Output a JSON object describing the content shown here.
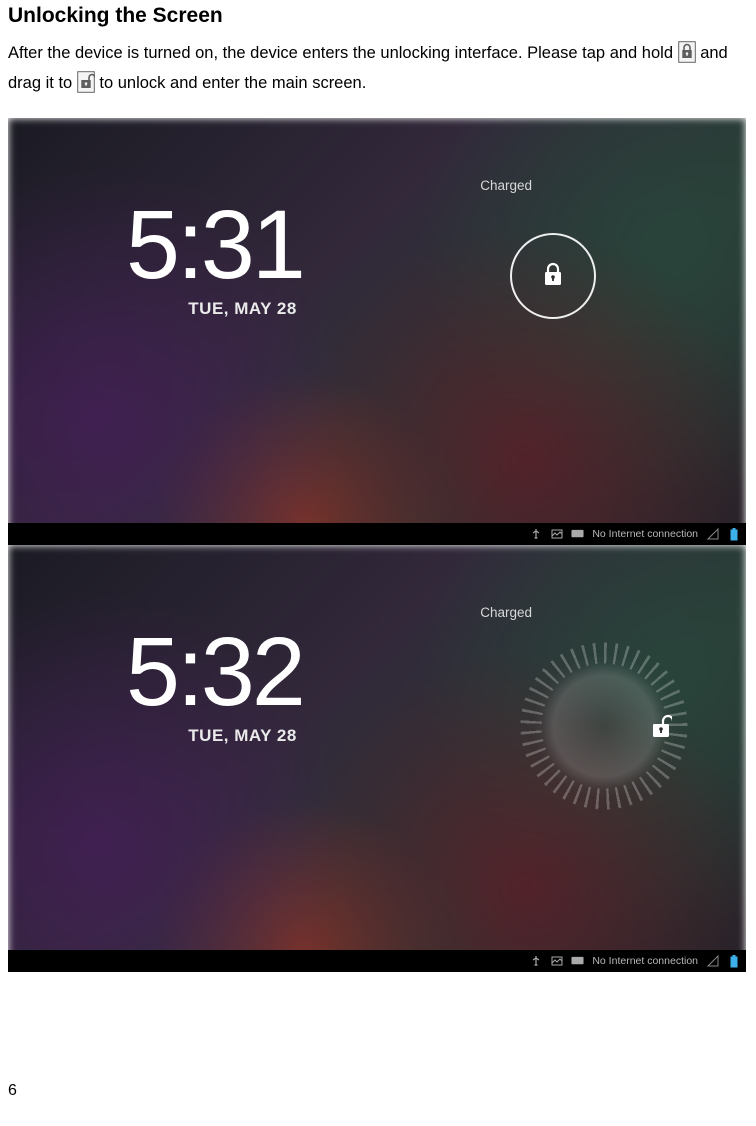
{
  "heading": "Unlocking the Screen",
  "body": {
    "part1": "After the device is turned on, the device enters the unlocking interface. Please tap and hold ",
    "part2": " and drag it to ",
    "part3": " to unlock and enter the main screen."
  },
  "screenshot1": {
    "charged": "Charged",
    "time": "5:31",
    "date": "TUE, MAY 28",
    "statusbar": {
      "text": "No Internet connection"
    }
  },
  "screenshot2": {
    "charged": "Charged",
    "time": "5:32",
    "date": "TUE, MAY 28",
    "statusbar": {
      "text": "No Internet connection"
    }
  },
  "page_number": "6"
}
